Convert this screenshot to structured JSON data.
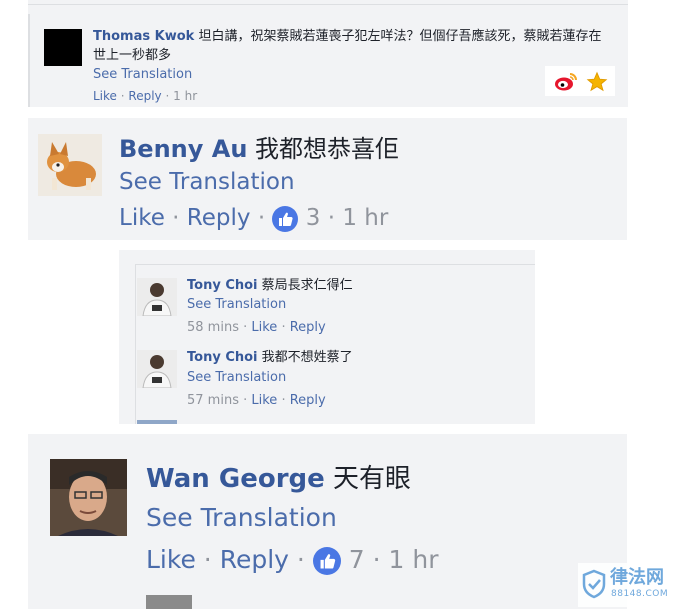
{
  "comments": [
    {
      "name": "Thomas Kwok",
      "text": "坦白講，祝架蔡賊若蓮喪子犯左咩法？但個仔吾應該死，蔡賊若蓮存在世上一秒都多",
      "see_translation": "See Translation",
      "like": "Like",
      "reply": "Reply",
      "time": "1 hr"
    },
    {
      "name": "Benny Au",
      "text": "我都想恭喜佢",
      "see_translation": "See Translation",
      "like": "Like",
      "reply": "Reply",
      "reactions": "3",
      "time": "1 hr"
    },
    {
      "name": "Tony Choi",
      "text": "蔡局長求仁得仁",
      "see_translation": "See Translation",
      "time": "58 mins",
      "like": "Like",
      "reply": "Reply"
    },
    {
      "name": "Tony Choi",
      "text": "我都不想姓蔡了",
      "see_translation": "See Translation",
      "time": "57 mins",
      "like": "Like",
      "reply": "Reply"
    },
    {
      "name": "Wan George",
      "text": "天有眼",
      "see_translation": "See Translation",
      "like": "Like",
      "reply": "Reply",
      "reactions": "7",
      "time": "1 hr"
    }
  ],
  "separator": "·",
  "watermark": {
    "text": "律法网",
    "sub": "88148.COM",
    "color": "#6fa8dc"
  },
  "colors": {
    "name": "#365899",
    "link": "#4b6cab",
    "meta": "#90949c",
    "like_badge": "#4a77e4",
    "panel": "#f2f3f5"
  }
}
